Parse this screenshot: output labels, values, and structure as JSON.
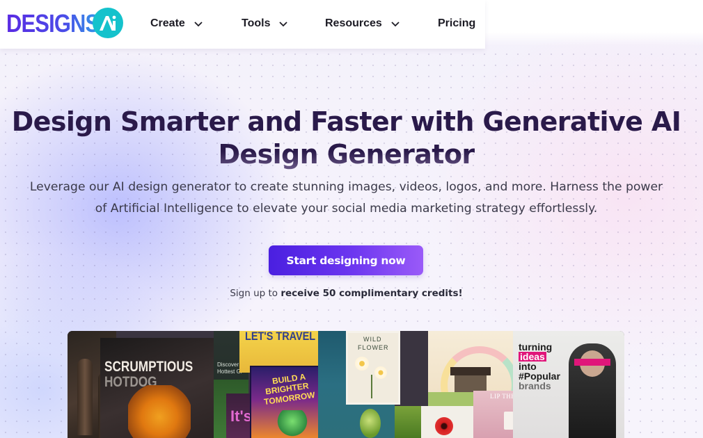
{
  "brand": {
    "name": "DESIGNS.",
    "badge": "AI",
    "colors": {
      "primary": "#5b2ee5",
      "accent": "#14c2cc",
      "text": "#2a1a4a"
    }
  },
  "nav": {
    "items": [
      {
        "label": "Create",
        "has_dropdown": true,
        "icon": "chevron-down-icon"
      },
      {
        "label": "Tools",
        "has_dropdown": true,
        "icon": "chevron-down-icon"
      },
      {
        "label": "Resources",
        "has_dropdown": true,
        "icon": "chevron-down-icon"
      },
      {
        "label": "Pricing",
        "has_dropdown": false
      }
    ]
  },
  "hero": {
    "title_line1": "Design Smarter and Faster with Generative AI",
    "title_line2": "Design Generator",
    "subtitle_line1": "Leverage our AI design generator to create stunning images, videos, logos, and more. Harness the power",
    "subtitle_line2": "of Artificial Intelligence to elevate your social media marketing strategy effortlessly.",
    "cta_label": "Start designing now",
    "signup_prefix": "Sign up to ",
    "signup_bold": "receive 50 complimentary credits!"
  },
  "collage": {
    "tiles": [
      {
        "name": "scrumptious-tile",
        "text_line1": "SCRUMPTIOUS",
        "text_line2": "HOTDOG"
      },
      {
        "name": "discover-tile",
        "text_line1": "Discover th",
        "text_line2": "Hottest Gr"
      },
      {
        "name": "lets-travel-tile",
        "text": "LET'S TRAVEL"
      },
      {
        "name": "build-brighter-tile",
        "text_line1": "BUILD A",
        "text_line2": "BRIGHTER",
        "text_line3": "TOMORROW"
      },
      {
        "name": "wild-flower-tile",
        "text_line1": "WILD",
        "text_line2": "FLOWER"
      },
      {
        "name": "house-tile",
        "text": ""
      },
      {
        "name": "lip-therapy-tile",
        "text": "LIP THERAPY"
      },
      {
        "name": "popular-brands-tile",
        "text_line1": "turning",
        "text_line2": "ideas",
        "text_line3": "into",
        "text_line4": "#Popular",
        "text_line5": "brands"
      },
      {
        "name": "its-tile",
        "text": "It's"
      }
    ]
  }
}
